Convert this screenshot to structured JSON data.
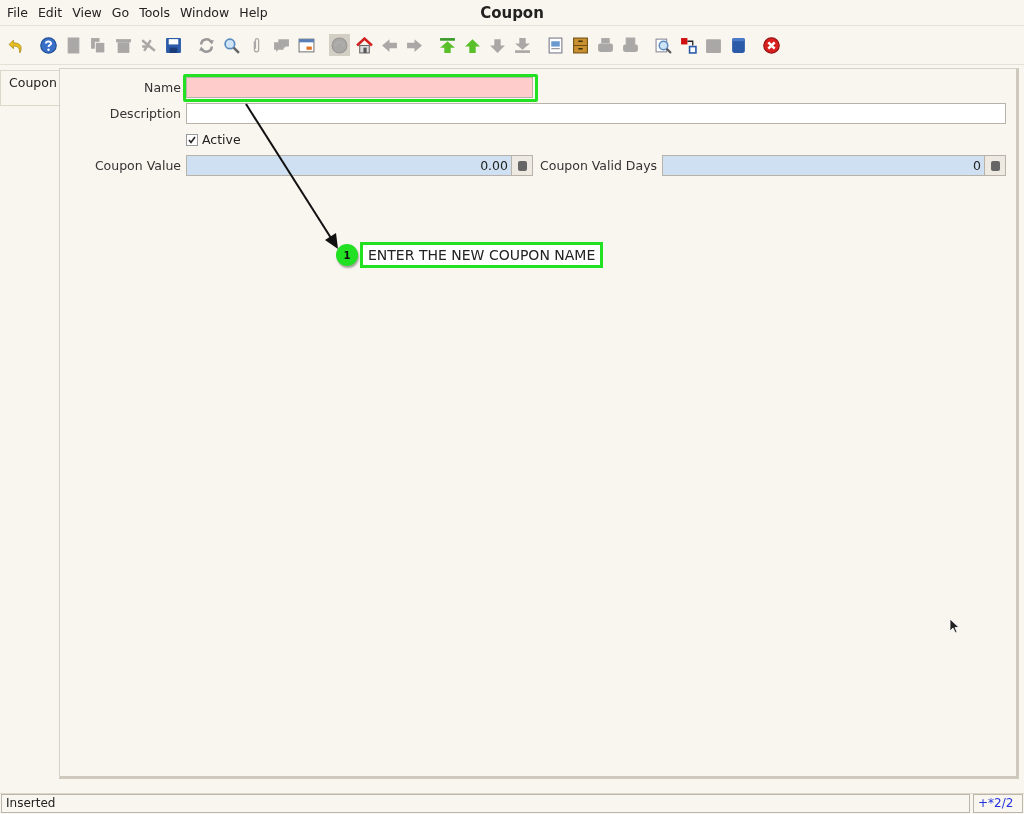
{
  "window": {
    "title": "Coupon"
  },
  "menu": [
    {
      "label": "File"
    },
    {
      "label": "Edit"
    },
    {
      "label": "View"
    },
    {
      "label": "Go"
    },
    {
      "label": "Tools"
    },
    {
      "label": "Window"
    },
    {
      "label": "Help"
    }
  ],
  "toolbar": [
    [
      {
        "kind": "undo",
        "disabled": false,
        "pressed": false
      }
    ],
    [
      {
        "kind": "help",
        "disabled": false,
        "pressed": false
      },
      {
        "kind": "new",
        "disabled": true,
        "pressed": false
      },
      {
        "kind": "copy",
        "disabled": true,
        "pressed": false
      },
      {
        "kind": "delete",
        "disabled": true,
        "pressed": false
      },
      {
        "kind": "delete-selection",
        "disabled": true,
        "pressed": false
      },
      {
        "kind": "save",
        "disabled": false,
        "pressed": false
      }
    ],
    [
      {
        "kind": "refresh",
        "disabled": false,
        "pressed": false
      },
      {
        "kind": "find",
        "disabled": false,
        "pressed": false
      },
      {
        "kind": "attachment",
        "disabled": true,
        "pressed": false
      },
      {
        "kind": "chat",
        "disabled": true,
        "pressed": false
      },
      {
        "kind": "grid",
        "disabled": false,
        "pressed": false
      }
    ],
    [
      {
        "kind": "history",
        "disabled": true,
        "pressed": true
      },
      {
        "kind": "home",
        "disabled": false,
        "pressed": false
      },
      {
        "kind": "previous",
        "disabled": true,
        "pressed": false
      },
      {
        "kind": "next",
        "disabled": true,
        "pressed": false
      }
    ],
    [
      {
        "kind": "first",
        "disabled": false,
        "pressed": false
      },
      {
        "kind": "prior",
        "disabled": false,
        "pressed": false
      },
      {
        "kind": "down",
        "disabled": true,
        "pressed": false
      },
      {
        "kind": "last",
        "disabled": true,
        "pressed": false
      }
    ],
    [
      {
        "kind": "report",
        "disabled": false,
        "pressed": false
      },
      {
        "kind": "archive",
        "disabled": false,
        "pressed": false
      },
      {
        "kind": "print",
        "disabled": true,
        "pressed": false
      },
      {
        "kind": "print-preview",
        "disabled": true,
        "pressed": false
      }
    ],
    [
      {
        "kind": "zoom-across",
        "disabled": false,
        "pressed": false
      },
      {
        "kind": "workflow",
        "disabled": false,
        "pressed": false
      },
      {
        "kind": "product",
        "disabled": true,
        "pressed": false
      },
      {
        "kind": "box",
        "disabled": false,
        "pressed": false
      }
    ],
    [
      {
        "kind": "exit",
        "disabled": false,
        "pressed": false
      }
    ]
  ],
  "tabs": [
    {
      "label": "Coupon",
      "selected": true
    }
  ],
  "form": {
    "rows": [
      [
        {
          "kind": "text",
          "label": "Name",
          "mandatory": true
        }
      ],
      [
        {
          "kind": "text",
          "label": "Description",
          "mandatory": false
        }
      ],
      [
        {
          "kind": "checkbox",
          "label": "Active",
          "checked": true
        }
      ],
      [
        {
          "kind": "number",
          "label": "Coupon Value",
          "value": "0.00"
        },
        {
          "kind": "number",
          "label": "Coupon Valid Days",
          "value": "0"
        }
      ]
    ]
  },
  "annotation": {
    "step": "1",
    "text": "ENTER THE NEW COUPON NAME"
  },
  "status_bar": {
    "message": "Inserted",
    "record": "+*2/2"
  }
}
